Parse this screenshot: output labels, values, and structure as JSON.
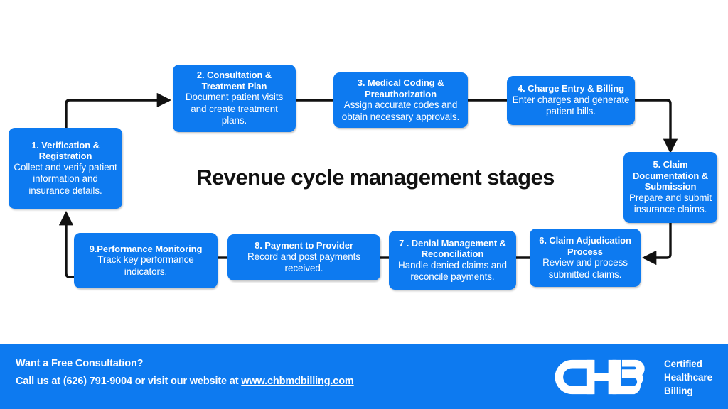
{
  "diagram": {
    "title": "Revenue cycle management stages",
    "box_color": "#0d7af0",
    "connector_color": "#111111",
    "nodes": [
      {
        "id": "node-1",
        "title": "1. Verification & Registration",
        "desc": "Collect and verify patient information and insurance details."
      },
      {
        "id": "node-2",
        "title": "2. Consultation & Treatment Plan",
        "desc": "Document patient visits and create treatment plans."
      },
      {
        "id": "node-3",
        "title": "3. Medical Coding & Preauthorization",
        "desc": "Assign accurate codes and obtain necessary approvals."
      },
      {
        "id": "node-4",
        "title": "4. Charge Entry & Billing",
        "desc": "Enter charges and generate patient bills."
      },
      {
        "id": "node-5",
        "title": "5. Claim Documentation & Submission",
        "desc": "Prepare and submit insurance claims."
      },
      {
        "id": "node-6",
        "title": "6. Claim Adjudication Process",
        "desc": "Review and process submitted claims."
      },
      {
        "id": "node-7",
        "title": "7 . Denial Management & Reconciliation",
        "desc": "Handle denied claims and reconcile payments."
      },
      {
        "id": "node-8",
        "title": "8. Payment to Provider",
        "desc": "Record and post payments received."
      },
      {
        "id": "node-9",
        "title": "9.Performance Monitoring",
        "desc": "Track key performance indicators."
      }
    ]
  },
  "footer": {
    "background": "#0d7af0",
    "headline": "Want a Free Consultation?",
    "call_prefix": "Call us at (626) 791-9004 or visit our website at ",
    "website": "www.chbmdbilling.com",
    "logo_monogram": "CHB",
    "logo_line1": "Certified",
    "logo_line2": "Healthcare",
    "logo_line3": "Billing"
  }
}
